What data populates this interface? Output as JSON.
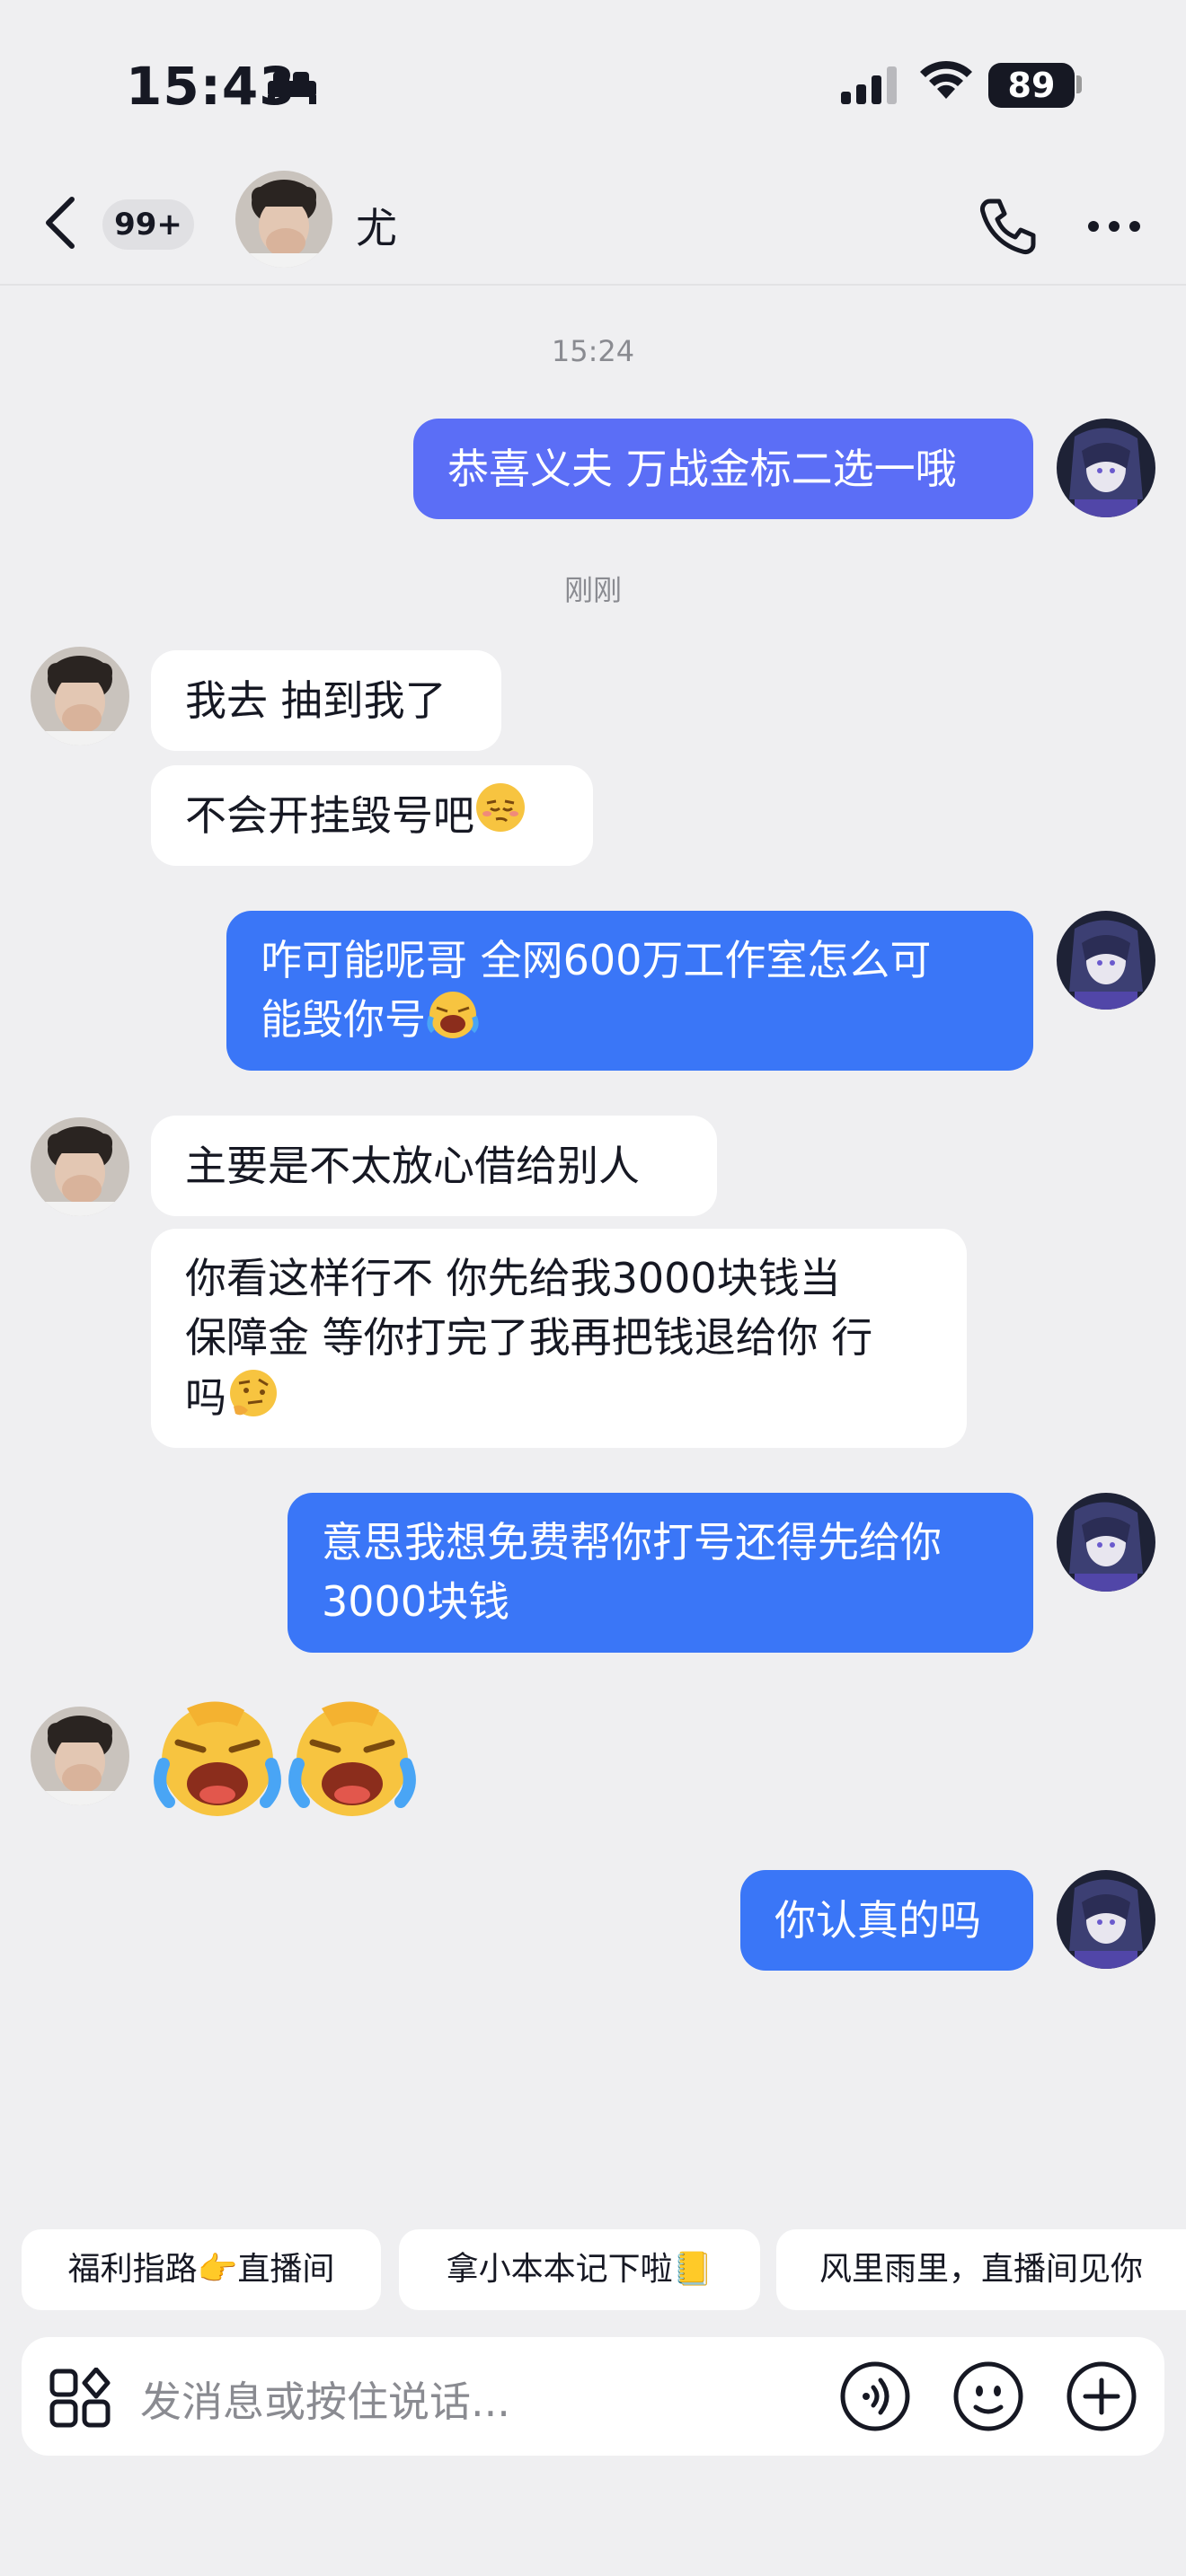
{
  "status_bar": {
    "time": "15:43",
    "battery": "89"
  },
  "header": {
    "unread_badge": "99+",
    "contact_name": "尤"
  },
  "messages": [
    {
      "type": "time",
      "text": "15:24"
    },
    {
      "type": "me",
      "text": "恭喜义夫 万战金标二选一哦"
    },
    {
      "type": "time",
      "text": "刚刚"
    },
    {
      "type": "other",
      "text": "我去 抽到我了"
    },
    {
      "type": "other",
      "text": "不会开挂毁号吧"
    },
    {
      "type": "me",
      "line1": "咋可能呢哥 全网600万工作室怎么可",
      "line2": "能毁你号"
    },
    {
      "type": "other",
      "text": "主要是不太放心借给别人"
    },
    {
      "type": "other",
      "line1": "你看这样行不 你先给我3000块钱当",
      "line2": "保障金 等你打完了我再把钱退给你 行",
      "line3": "吗"
    },
    {
      "type": "me",
      "line1": "意思我想免费帮你打号还得先给你",
      "line2": "3000块钱"
    },
    {
      "type": "other_emoji",
      "count": 2
    },
    {
      "type": "me",
      "text": "你认真的吗"
    }
  ],
  "quick_replies": [
    "福利指路👉直播间",
    "拿小本本记下啦📒",
    "风里雨里，直播间见你"
  ],
  "input": {
    "placeholder": "发消息或按住说话..."
  },
  "colors": {
    "my_bubble": "#3a76f7",
    "my_bubble_first": "#5b6ef6",
    "background": "#efeff1"
  }
}
